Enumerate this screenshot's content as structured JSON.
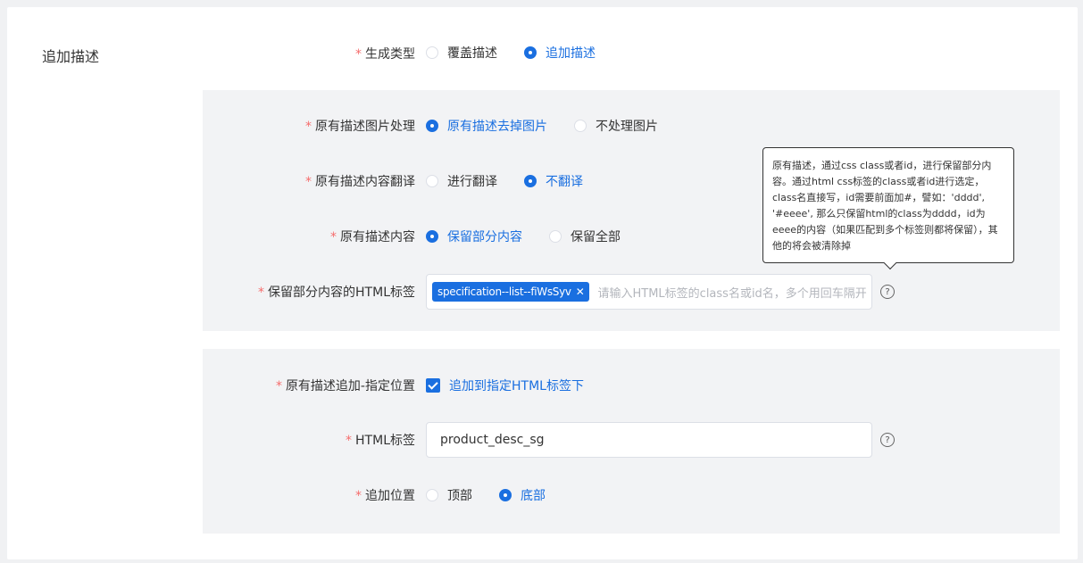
{
  "section_title": "追加描述",
  "generate_type": {
    "label": "生成类型",
    "options": [
      "覆盖描述",
      "追加描述"
    ],
    "selected": "追加描述"
  },
  "image_handling": {
    "label": "原有描述图片处理",
    "options": [
      "原有描述去掉图片",
      "不处理图片"
    ],
    "selected": "原有描述去掉图片"
  },
  "translate": {
    "label": "原有描述内容翻译",
    "options": [
      "进行翻译",
      "不翻译"
    ],
    "selected": "不翻译"
  },
  "content": {
    "label": "原有描述内容",
    "options": [
      "保留部分内容",
      "保留全部"
    ],
    "selected": "保留部分内容"
  },
  "keep_tags": {
    "label": "保留部分内容的HTML标签",
    "tag": "specification--list--fiWsSyv",
    "placeholder": "请输入HTML标签的class名或id名，多个用回车隔开"
  },
  "tooltip": "原有描述，通过css class或者id，进行保留部分内容。通过html css标签的class或者id进行选定，class名直接写，id需要前面加#，譬如：'dddd', '#eeee', 那么只保留html的class为dddd，id为eeee的内容（如果匹配到多个标签则都将保留），其他的将会被清除掉",
  "append_position": {
    "label": "原有描述追加-指定位置",
    "checkbox_label": "追加到指定HTML标签下",
    "checked": true
  },
  "html_tag": {
    "label": "HTML标签",
    "value": "product_desc_sg"
  },
  "position": {
    "label": "追加位置",
    "options": [
      "顶部",
      "底部"
    ],
    "selected": "底部"
  },
  "required_mark": "*",
  "help_glyph": "?",
  "colors": {
    "accent": "#1a6fe0",
    "required": "#f56c6c",
    "panel": "#f2f3f5"
  }
}
